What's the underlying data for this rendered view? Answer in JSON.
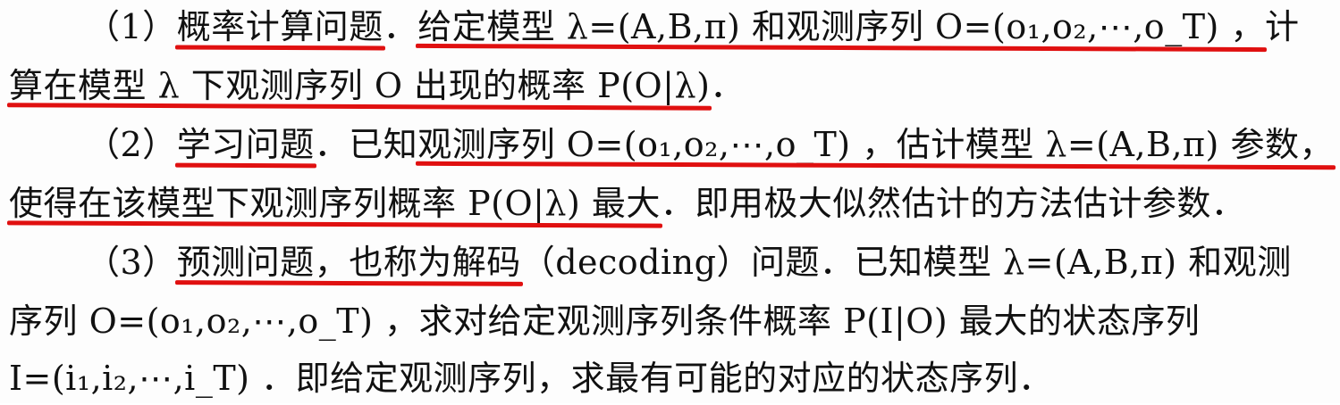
{
  "lines": [
    {
      "parts": [
        "（1）",
        "概率计算问题",
        "．",
        "给定模型 λ=(A,B,π) 和观测序列 O=(o₁,o₂,⋯,o_T) ，",
        "计"
      ]
    },
    {
      "parts": [
        "算在模型 λ 下观测序列 O 出现的概率 P(O|λ)",
        "．"
      ]
    },
    {
      "parts": [
        "（2）",
        "学习问题",
        "．已知",
        "观测序列 O=(o₁,o₂,⋯,o_T) ，估计模型 λ=(A,B,π) 参数，"
      ]
    },
    {
      "parts": [
        "使得在该模型下观测序列概率 P(O|λ) 最大",
        "．即用极大似然估计的方法估计参数．"
      ]
    },
    {
      "parts": [
        "（3）",
        "预测问题，也称为解码",
        "（decoding）问题．已知模型 λ=(A,B,π) 和观测"
      ]
    },
    {
      "parts": [
        "序列 O=(o₁,o₂,⋯,o_T) ，求对给定观测序列条件概率 P(I|O) 最大的状态序列"
      ]
    },
    {
      "parts": [
        "I=(i₁,i₂,⋯,i_T) ．即给定观测序列，求最有可能的对应的状态序列．"
      ]
    }
  ],
  "colors": {
    "underline": "#e01010",
    "text": "#111111",
    "background": "#fdfdfd"
  }
}
